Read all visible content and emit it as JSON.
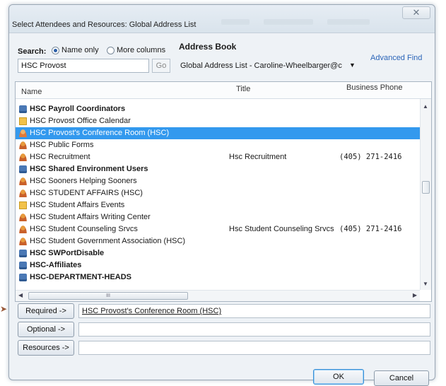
{
  "window": {
    "title": "Select Attendees and Resources: Global Address List",
    "close_glyph": "✕"
  },
  "search": {
    "label": "Search:",
    "option_name_only": "Name only",
    "option_more_columns": "More columns",
    "selected_option": "Name only",
    "input_value": "HSC Provost",
    "go_label": "Go"
  },
  "address_book": {
    "label": "Address Book",
    "selected": "Global Address List - Caroline-Wheelbarger@c",
    "advanced_find": "Advanced Find"
  },
  "grid": {
    "columns": [
      "Name",
      "Title",
      "Business Phone"
    ],
    "rows": [
      {
        "icon": "group",
        "name": "HSC Payroll Coordinators",
        "bold": true,
        "title": "",
        "phone": ""
      },
      {
        "icon": "calendar",
        "name": "HSC Provost Office Calendar",
        "bold": false,
        "title": "",
        "phone": ""
      },
      {
        "icon": "room",
        "name": "HSC Provost's Conference Room (HSC)",
        "bold": false,
        "title": "",
        "phone": "",
        "selected": true
      },
      {
        "icon": "person",
        "name": "HSC Public Forms",
        "bold": false,
        "title": "",
        "phone": ""
      },
      {
        "icon": "person",
        "name": "HSC Recruitment",
        "bold": false,
        "title": "Hsc Recruitment",
        "phone": "(405) 271-2416"
      },
      {
        "icon": "group",
        "name": "HSC Shared Environment Users",
        "bold": true,
        "title": "",
        "phone": ""
      },
      {
        "icon": "person",
        "name": "HSC Sooners Helping Sooners",
        "bold": false,
        "title": "",
        "phone": ""
      },
      {
        "icon": "person",
        "name": "HSC STUDENT AFFAIRS (HSC)",
        "bold": false,
        "title": "",
        "phone": ""
      },
      {
        "icon": "calendar",
        "name": "HSC Student Affairs Events",
        "bold": false,
        "title": "",
        "phone": ""
      },
      {
        "icon": "person",
        "name": "HSC Student Affairs Writing Center",
        "bold": false,
        "title": "",
        "phone": ""
      },
      {
        "icon": "person",
        "name": "HSC Student Counseling Srvcs",
        "bold": false,
        "title": "Hsc Student Counseling Srvcs",
        "phone": "(405) 271-2416"
      },
      {
        "icon": "person",
        "name": "HSC Student Government Association (HSC)",
        "bold": false,
        "title": "",
        "phone": ""
      },
      {
        "icon": "group",
        "name": "HSC SWPortDisable",
        "bold": true,
        "title": "",
        "phone": ""
      },
      {
        "icon": "group",
        "name": "HSC-Affiliates",
        "bold": true,
        "title": "",
        "phone": ""
      },
      {
        "icon": "group",
        "name": "HSC-DEPARTMENT-HEADS",
        "bold": true,
        "title": "",
        "phone": ""
      }
    ],
    "hscroll_grip": "III"
  },
  "recipients": {
    "required_label": "Required ->",
    "required_value": "HSC Provost's Conference Room (HSC)",
    "optional_label": "Optional ->",
    "optional_value": "",
    "resources_label": "Resources ->",
    "resources_value": ""
  },
  "footer": {
    "ok_label": "OK",
    "cancel_label": "Cancel"
  },
  "colors": {
    "selection": "#3399ee",
    "link": "#2a64b8"
  }
}
